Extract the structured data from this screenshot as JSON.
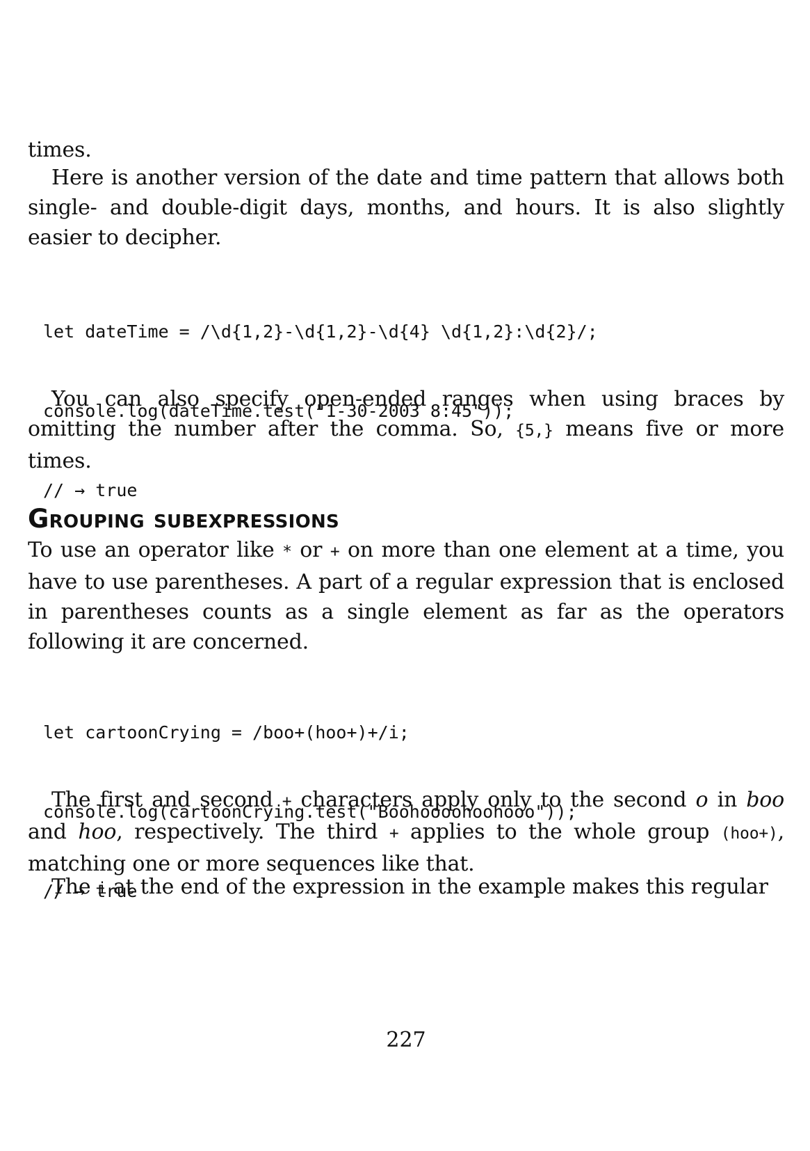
{
  "paragraphs": {
    "p0": "times.",
    "p1": "Here is another version of the date and time pattern that allows both single- and double-digit days, months, and hours. It is also slightly easier to decipher.",
    "p2": {
      "before": "You can also specify open-ended ranges when using braces by omitting the number after the comma. So, ",
      "code": "{5,}",
      "after": " means five or more times."
    },
    "p3": {
      "t1": "To use an operator like ",
      "c1": "*",
      "t2": " or ",
      "c2": "+",
      "t3": " on more than one element at a time, you have to use parentheses. A part of a regular expression that is enclosed in parentheses counts as a single element as far as the operators following it are concerned."
    },
    "p4": {
      "t1": "The first and second ",
      "c1": "+",
      "t2": " characters apply only to the second ",
      "i1": "o",
      "t3": " in ",
      "i2": "boo",
      "t4": " and ",
      "i3": "hoo",
      "t5": ", respectively. The third ",
      "c2": "+",
      "t6": " applies to the whole group ",
      "c3": "(hoo+)",
      "t7": ", matching one or more sequences like that."
    },
    "p5": {
      "t1": "The ",
      "c1": "i",
      "t2": " at the end of the expression in the example makes this regular"
    }
  },
  "code_blocks": {
    "block1": [
      "let dateTime = /\\d{1,2}-\\d{1,2}-\\d{4} \\d{1,2}:\\d{2}/;",
      "console.log(dateTime.test(\"1-30-2003 8:45\"));",
      "// → true"
    ],
    "block2": [
      "let cartoonCrying = /boo+(hoo+)+/i;",
      "console.log(cartoonCrying.test(\"Boohoooohoohooo\"));",
      "// → true"
    ]
  },
  "heading": "Grouping subexpressions",
  "page_number": "227"
}
